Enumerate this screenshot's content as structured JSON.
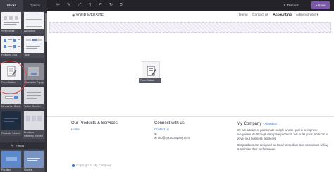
{
  "sidebar": {
    "tabs": [
      "Blocks",
      "Options"
    ],
    "snippets": [
      "References",
      "Accordion",
      "Features Grid",
      "Tabs",
      "Form Builder",
      "Newsletter Popup",
      "Newsletter Block",
      "Twitter Scroller",
      "Products Search",
      "Products Recently Viewed",
      "Parallax",
      "Quotes"
    ],
    "effects_label": "Effects"
  },
  "toolbar": {
    "discard_label": "Discard",
    "save_label": "Save"
  },
  "site": {
    "logo_text": "YOUR WEBSITE",
    "nav": [
      "Home",
      "Contact us",
      "Accounting",
      "Administrator ▾"
    ]
  },
  "drag": {
    "tooltip": "Form Builder"
  },
  "footer": {
    "col1": {
      "title": "Our Products & Services",
      "link": "Home"
    },
    "col2": {
      "title": "Connect with us",
      "contact": "Contact us",
      "phone": "",
      "email": "info@yourcompany.com"
    },
    "col3": {
      "title": "My Company",
      "about": "- About us",
      "p1": "We are a team of passionate people whose goal is to improve everyone's life through disruptive products. We build great products to solve your business problems.",
      "p2": "Our products are designed for small to medium size companies willing to optimize their performance."
    },
    "copyright": "Copyright © My Company"
  },
  "colors": {
    "sidebar_bg": "#3d3d47",
    "toolbar_bg": "#232329",
    "save_button": "#7a5aa7",
    "link_blue": "#3a6fc4",
    "highlight_circle": "#e24c4c"
  },
  "icons": [
    "undo-icon",
    "redo-icon",
    "crop-icon",
    "fullscreen-icon",
    "mobile-icon",
    "refresh-icon",
    "close-icon",
    "floppy-icon",
    "form-icon",
    "globe-icon",
    "phone-icon",
    "envelope-icon",
    "magic-icon"
  ]
}
